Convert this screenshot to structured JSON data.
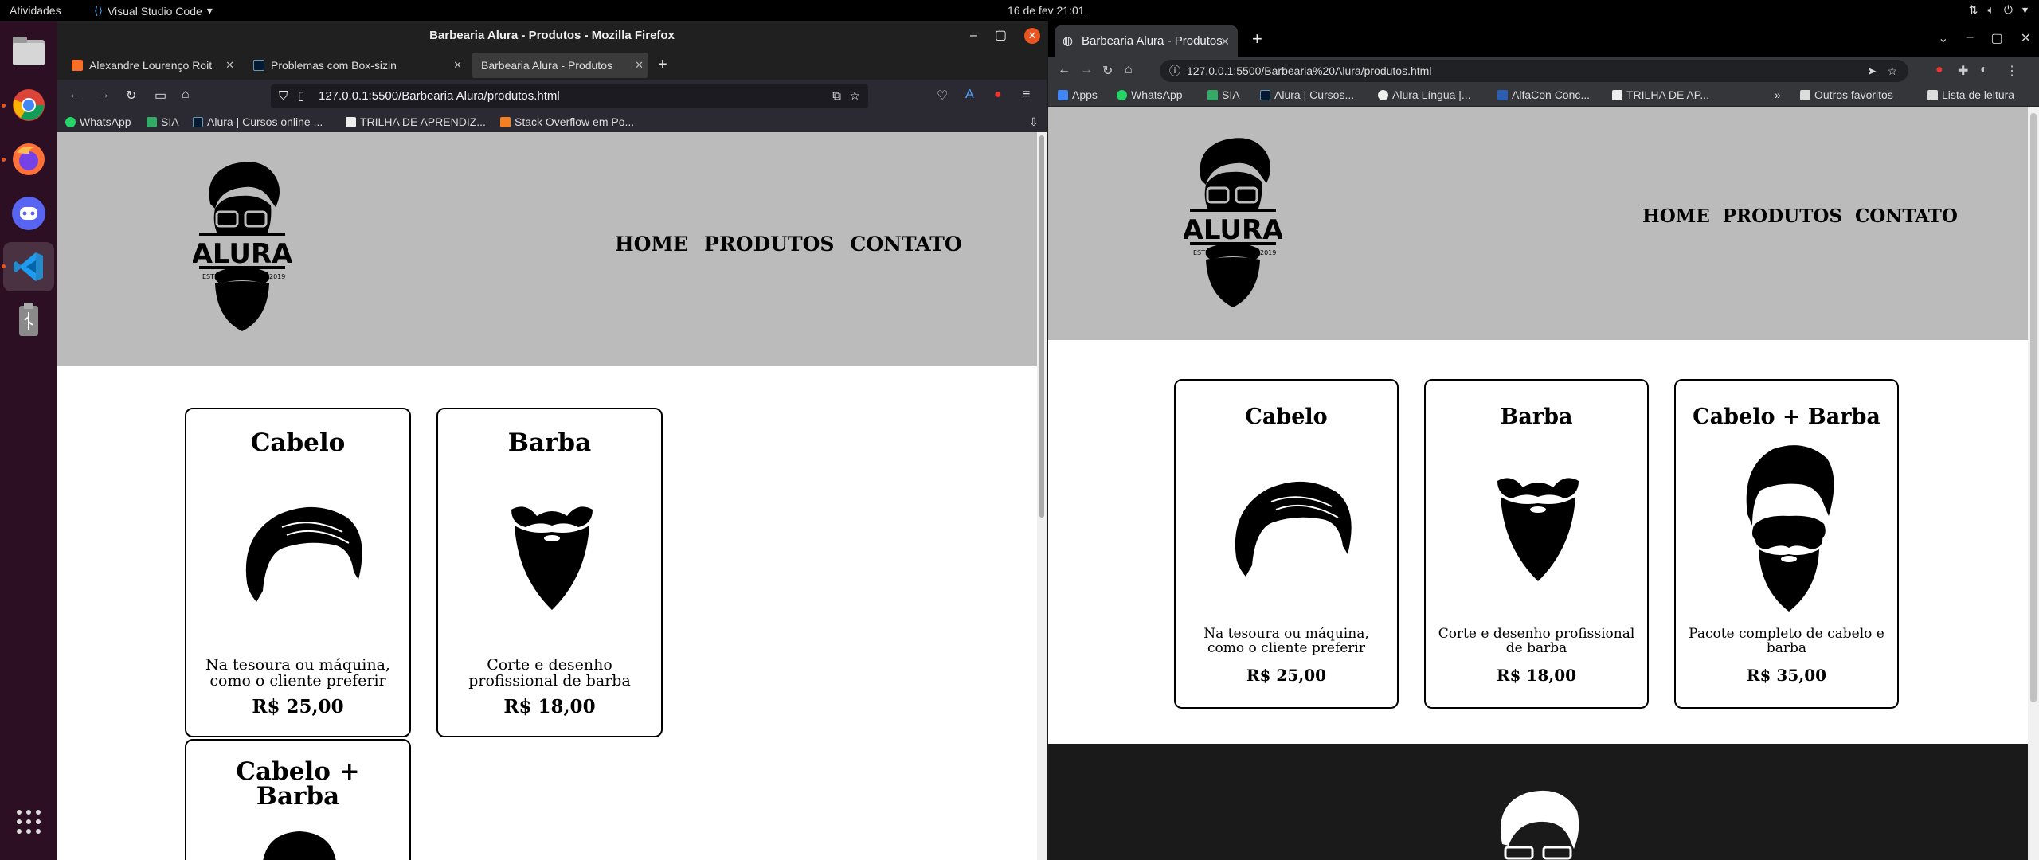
{
  "desktop": {
    "activities": "Atividades",
    "app_menu": "Visual Studio Code",
    "clock": "16 de fev  21:01"
  },
  "firefox": {
    "window_title": "Barbearia Alura - Produtos - Mozilla Firefox",
    "tabs": [
      {
        "label": "Alexandre Lourenço Roit"
      },
      {
        "label": "Problemas com Box-sizin"
      },
      {
        "label": "Barbearia Alura - Produtos"
      }
    ],
    "url": "127.0.0.1:5500/Barbearia Alura/produtos.html",
    "bookmarks": [
      "WhatsApp",
      "SIA",
      "Alura | Cursos online ...",
      "TRILHA DE APRENDIZ...",
      "Stack Overflow em Po..."
    ]
  },
  "chrome": {
    "tab_label": "Barbearia Alura - Produtos",
    "url": "127.0.0.1:5500/Barbearia%20Alura/produtos.html",
    "bookmarks": [
      "Apps",
      "WhatsApp",
      "SIA",
      "Alura | Cursos...",
      "Alura Língua |...",
      "AlfaCon Conc...",
      "TRILHA DE AP..."
    ],
    "other_bookmarks": "Outros favoritos",
    "reading_list": "Lista de leitura"
  },
  "site": {
    "logo_text": "ALURA",
    "logo_estd": "ESTD",
    "logo_year": "2019",
    "nav": [
      "HOME",
      "PRODUTOS",
      "CONTATO"
    ],
    "products": [
      {
        "title": "Cabelo",
        "desc": "Na tesoura ou máquina, como o cliente preferir",
        "price": "R$ 25,00"
      },
      {
        "title": "Barba",
        "desc": "Corte e desenho profissional de barba",
        "price": "R$ 18,00"
      },
      {
        "title": "Cabelo + Barba",
        "desc": "Pacote completo de cabelo e barba",
        "price": "R$ 35,00"
      }
    ]
  },
  "colors": {
    "header_bg": "#bbbbbb",
    "footer_bg": "#1a1a1a",
    "dock_bg": "#2c0f22",
    "ubuntu_accent": "#e95420"
  }
}
